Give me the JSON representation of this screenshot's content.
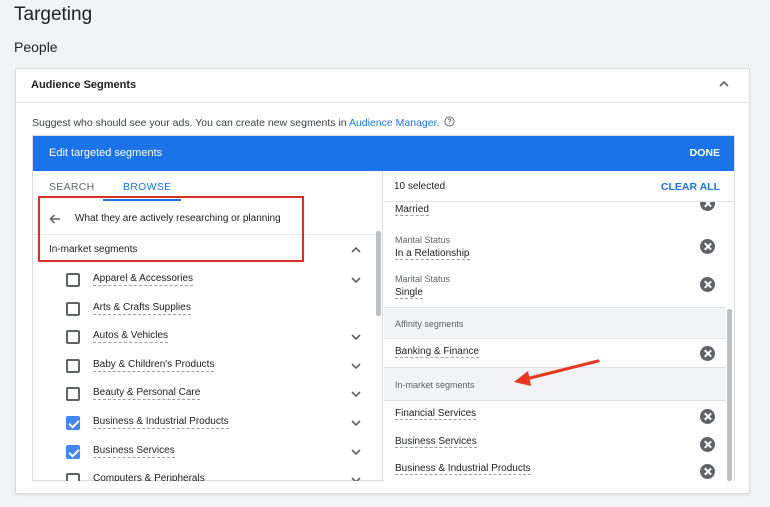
{
  "page": {
    "title": "Targeting",
    "section": "People"
  },
  "card": {
    "title": "Audience Segments",
    "suggest_text": "Suggest who should see your ads.  You can create new segments in ",
    "suggest_link": "Audience Manager",
    "suggest_end": ".",
    "editor": {
      "title": "Edit targeted segments",
      "done_label": "DONE"
    }
  },
  "left": {
    "tabs": [
      {
        "label": "SEARCH"
      },
      {
        "label": "BROWSE"
      }
    ],
    "back_label": "What they are actively researching or planning",
    "category_label": "In-market segments",
    "items": [
      {
        "label": "Apparel & Accessories",
        "checked": false,
        "expandable": true
      },
      {
        "label": "Arts & Crafts Supplies",
        "checked": false,
        "expandable": false
      },
      {
        "label": "Autos & Vehicles",
        "checked": false,
        "expandable": true
      },
      {
        "label": "Baby & Children's Products",
        "checked": false,
        "expandable": true
      },
      {
        "label": "Beauty & Personal Care",
        "checked": false,
        "expandable": true
      },
      {
        "label": "Business & Industrial Products",
        "checked": true,
        "expandable": true
      },
      {
        "label": "Business Services",
        "checked": true,
        "expandable": true
      },
      {
        "label": "Computers & Peripherals",
        "checked": false,
        "expandable": true
      }
    ]
  },
  "right": {
    "selected_count": "10 selected",
    "clear_all": "CLEAR ALL",
    "married": "Married",
    "relationship": {
      "small": "Marital Status",
      "value": "In a Relationship"
    },
    "single": {
      "small": "Marital Status",
      "value": "Single"
    },
    "affinity_group": "Affinity segments",
    "affinity_item": "Banking & Finance",
    "inmarket_group": "In-market segments",
    "inmarket_items": [
      "Financial Services",
      "Business Services",
      "Business & Industrial Products"
    ]
  },
  "colors": {
    "accent": "#1a73e8",
    "annotation": "#d93025",
    "checkbox_checked": "#4285f4"
  }
}
